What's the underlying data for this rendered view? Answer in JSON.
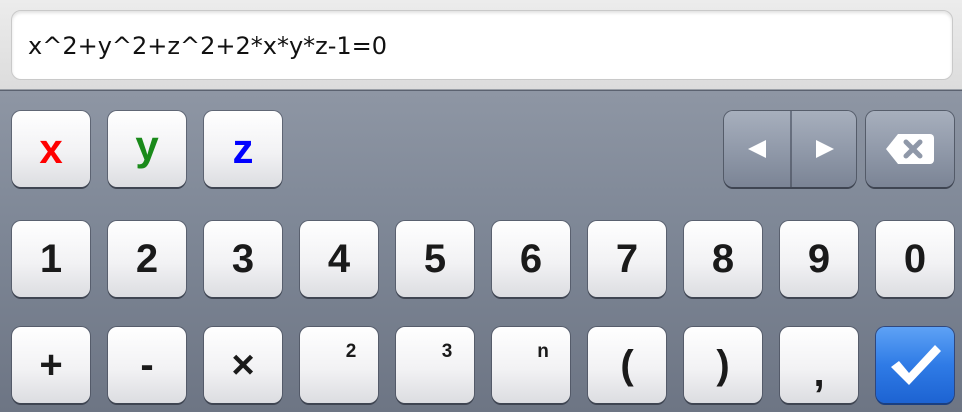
{
  "input": {
    "formula": "x^2+y^2+z^2+2*x*y*z-1=0"
  },
  "keyboard": {
    "variables": [
      {
        "label": "x",
        "color": "#ff0000"
      },
      {
        "label": "y",
        "color": "#1a8a1a"
      },
      {
        "label": "z",
        "color": "#0000ff"
      }
    ],
    "cursor_left_icon": "triangle-left-icon",
    "cursor_right_icon": "triangle-right-icon",
    "backspace_icon": "backspace-icon",
    "digits": [
      "1",
      "2",
      "3",
      "4",
      "5",
      "6",
      "7",
      "8",
      "9",
      "0"
    ],
    "operators": {
      "plus": "+",
      "minus": "-",
      "times": "×",
      "square": "2",
      "cube": "3",
      "power_n": "n",
      "open_paren": "(",
      "close_paren": ")",
      "comma": ","
    },
    "done_icon": "checkmark-icon",
    "done_color": "#2f7be6"
  }
}
